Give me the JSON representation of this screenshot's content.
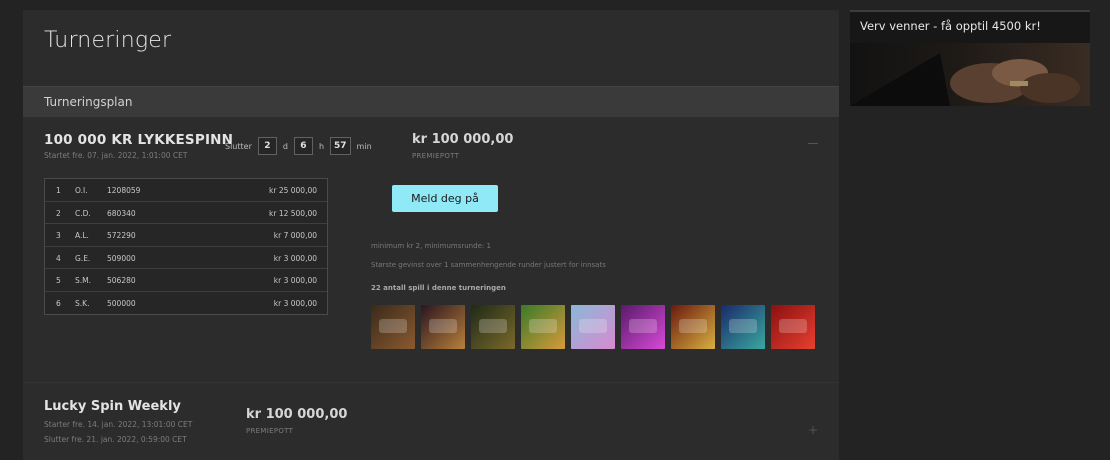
{
  "page": {
    "title": "Turneringer",
    "section_title": "Turneringsplan"
  },
  "tournament1": {
    "name": "100 000 KR LYKKESPINN",
    "started": "Startet fre. 07. jan. 2022, 1:01:00 CET",
    "ends_label": "Slutter",
    "countdown": {
      "days": "2",
      "days_unit": "d",
      "hours": "6",
      "hours_unit": "h",
      "minutes": "57",
      "minutes_unit": "min"
    },
    "prize": "kr 100 000,00",
    "prize_label": "PREMIEPOTT",
    "leaderboard": [
      {
        "rank": "1",
        "name": "O.I.",
        "id": "1208059",
        "amount": "kr 25 000,00"
      },
      {
        "rank": "2",
        "name": "C.D.",
        "id": "680340",
        "amount": "kr 12 500,00"
      },
      {
        "rank": "3",
        "name": "A.L.",
        "id": "572290",
        "amount": "kr 7 000,00"
      },
      {
        "rank": "4",
        "name": "G.E.",
        "id": "509000",
        "amount": "kr 3 000,00"
      },
      {
        "rank": "5",
        "name": "S.M.",
        "id": "506280",
        "amount": "kr 3 000,00"
      },
      {
        "rank": "6",
        "name": "S.K.",
        "id": "500000",
        "amount": "kr 3 000,00"
      }
    ],
    "join_label": "Meld deg på",
    "rule_min": "minimum kr 2, minimumsrunde: 1",
    "rule_win": "Største gevinst over 1 sammenhengende runder justert for innsats",
    "games_count": "22 antall spill i denne turneringen",
    "games": [
      {
        "icon": "game-thumb-1",
        "color1": "#3a2a1a",
        "color2": "#8a5a30"
      },
      {
        "icon": "game-thumb-2",
        "color1": "#2a1520",
        "color2": "#b8803a"
      },
      {
        "icon": "game-thumb-3",
        "color1": "#1f2a18",
        "color2": "#7a6a2a"
      },
      {
        "icon": "game-thumb-4",
        "color1": "#3a7a2a",
        "color2": "#d89a3a"
      },
      {
        "icon": "game-thumb-5",
        "color1": "#8ab8d8",
        "color2": "#d88ad0"
      },
      {
        "icon": "game-thumb-6",
        "color1": "#5a1a6a",
        "color2": "#d84ad8"
      },
      {
        "icon": "game-thumb-7",
        "color1": "#6a1a10",
        "color2": "#d8b040"
      },
      {
        "icon": "game-thumb-8",
        "color1": "#1a2a6a",
        "color2": "#3aa8a0"
      },
      {
        "icon": "game-thumb-9",
        "color1": "#8a1010",
        "color2": "#e84030"
      }
    ]
  },
  "tournament2": {
    "name": "Lucky Spin Weekly",
    "starts": "Starter fre. 14. jan. 2022, 13:01:00 CET",
    "ends": "Slutter fre. 21. jan. 2022, 0:59:00 CET",
    "prize": "kr 100 000,00",
    "prize_label": "PREMIEPOTT",
    "expand_symbol": "+"
  },
  "sidebar": {
    "banner_title": "Verv venner - få opptil 4500 kr!"
  },
  "colors": {
    "accent": "#8fe9f6",
    "panel": "#2c2c2c",
    "background": "#232323"
  }
}
